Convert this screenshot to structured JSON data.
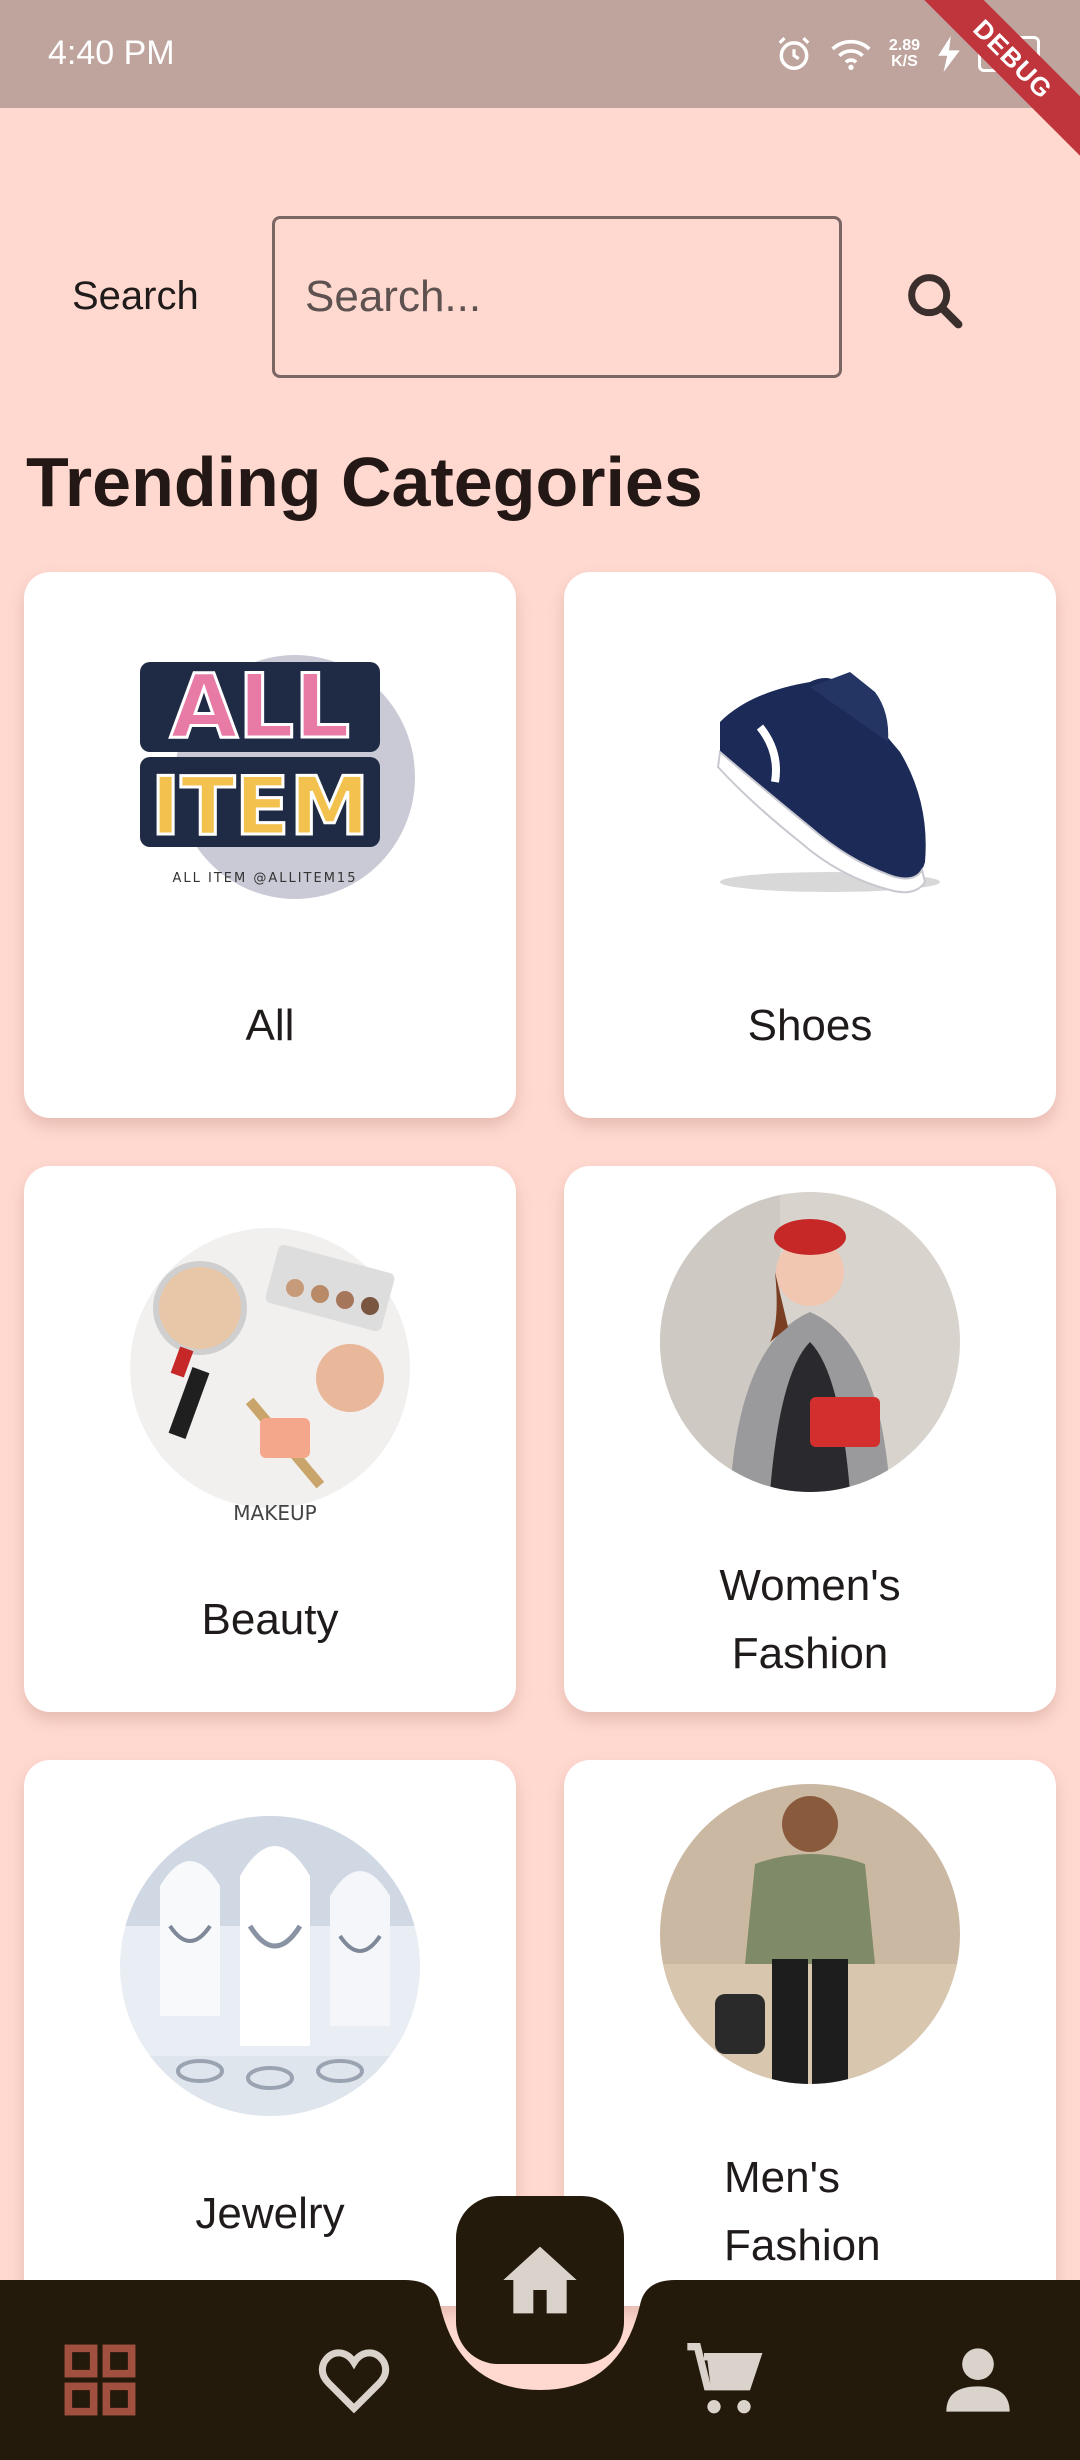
{
  "status_bar": {
    "time": "4:40 PM",
    "net_speed_value": "2.89",
    "net_speed_unit": "K/S",
    "battery": "59",
    "debug_banner": "DEBUG"
  },
  "search": {
    "label": "Search",
    "placeholder": "Search..."
  },
  "heading": "Trending Categories",
  "categories": [
    {
      "label": "All",
      "icon": "all-item-logo",
      "logo_text": [
        "ALL",
        "ITEM"
      ],
      "logo_caption": "ALL ITEM @ALLITEM15"
    },
    {
      "label": "Shoes",
      "icon": "shoe-image"
    },
    {
      "label": "Beauty",
      "icon": "makeup-image",
      "image_caption": "MAKEUP"
    },
    {
      "label": "Women's Fashion",
      "label_lines": [
        "Women's",
        "Fashion"
      ],
      "icon": "womens-fashion-image"
    },
    {
      "label": "Jewelry",
      "icon": "jewelry-image"
    },
    {
      "label": "Men's Fashion",
      "label_lines": [
        "Men's",
        "Fashion"
      ],
      "icon": "mens-fashion-image"
    }
  ],
  "bottom_nav": {
    "items": [
      "grid-icon",
      "heart-icon",
      "home-icon",
      "cart-icon",
      "profile-icon"
    ],
    "active": "home-icon",
    "colors": {
      "bar": "#231a0b",
      "active": "#a14f3e",
      "inactive": "#d9d3cc"
    }
  },
  "colors": {
    "background": "#ffd9d0",
    "status_bar": "#bfa49e",
    "debug": "#c0343c"
  }
}
